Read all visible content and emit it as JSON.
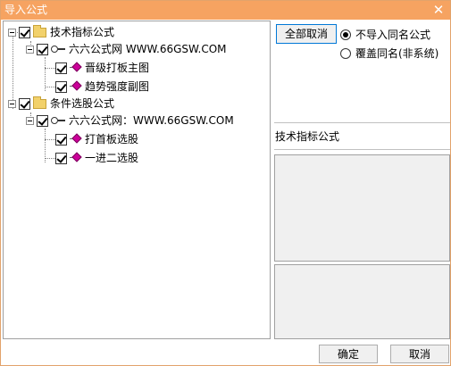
{
  "window": {
    "title": "导入公式"
  },
  "tree": {
    "groups": [
      {
        "label": "技术指标公式",
        "checked": true,
        "source": {
          "label": "六六公式网 WWW.66GSW.COM",
          "checked": true,
          "formulas": [
            {
              "label": "晋级打板主图",
              "checked": true
            },
            {
              "label": "趋势强度副图",
              "checked": true
            }
          ]
        }
      },
      {
        "label": "条件选股公式",
        "checked": true,
        "source": {
          "label": "六六公式网：WWW.66GSW.COM",
          "checked": true,
          "formulas": [
            {
              "label": "打首板选股",
              "checked": true
            },
            {
              "label": "一进二选股",
              "checked": true
            }
          ]
        }
      }
    ]
  },
  "options": {
    "deselect_all_label": "全部取消",
    "radio_skip_label": "不导入同名公式",
    "radio_overwrite_label": "覆盖同名(非系统)",
    "selected": "skip"
  },
  "details": {
    "type_label": "技术指标公式"
  },
  "footer": {
    "ok_label": "确定",
    "cancel_label": "取消"
  },
  "colors": {
    "titlebar": "#f6a361",
    "formula_icon": "#cc0099"
  }
}
